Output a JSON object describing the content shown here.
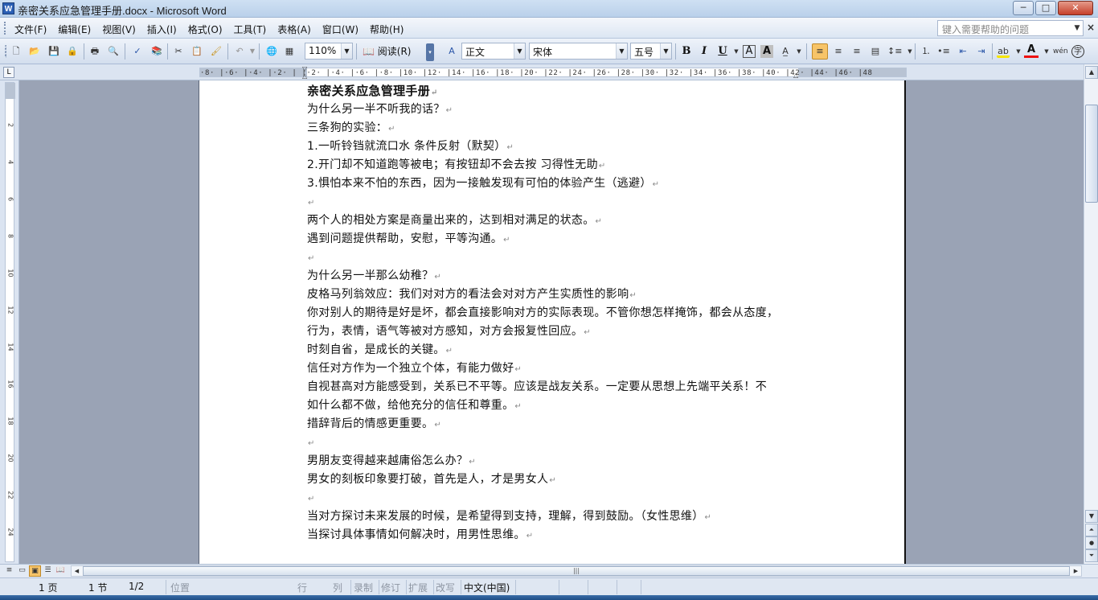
{
  "window": {
    "title": "亲密关系应急管理手册.docx - Microsoft Word",
    "app_icon": "W",
    "buttons": {
      "minimize": "─",
      "maximize": "□",
      "close": "✕"
    }
  },
  "menu": {
    "items": [
      "文件(F)",
      "编辑(E)",
      "视图(V)",
      "插入(I)",
      "格式(O)",
      "工具(T)",
      "表格(A)",
      "窗口(W)",
      "帮助(H)"
    ],
    "help_placeholder": "键入需要帮助的问题",
    "close_doc": "×"
  },
  "toolbar": {
    "zoom": "110%",
    "read_button": "阅读(R)",
    "style": "正文",
    "font": "宋体",
    "size": "五号",
    "bold": "B",
    "italic": "I",
    "underline": "U",
    "border_char": "A",
    "shade_char": "A",
    "font_color_char": "A",
    "active_alignment": "align-left",
    "accent_color": "#f7c468"
  },
  "ruler": {
    "ticks": "·8· |·6· |·4· |·2· |  |·2· |·4· |·6· |·8· |10· |12· |14· |16· |18· |20· |22· |24· |26· |28· |30· |32· |34· |36· |38· |40· |42· |44· |46· |48",
    "vertical": [
      "2",
      "4",
      "6",
      "8",
      "10",
      "12",
      "14",
      "16",
      "18",
      "20",
      "22",
      "24"
    ]
  },
  "document": {
    "paragraph_mark": "↵",
    "paragraphs": [
      {
        "text": "亲密关系应急管理手册",
        "heading": true
      },
      {
        "text": "为什么另一半不听我的话？"
      },
      {
        "text": "三条狗的实验："
      },
      {
        "text": "1.一听铃铛就流口水  条件反射（默契）"
      },
      {
        "text": "2.开门却不知道跑等被电；有按钮却不会去按  习得性无助"
      },
      {
        "text": "3.惧怕本来不怕的东西，因为一接触发现有可怕的体验产生（逃避）"
      },
      {
        "text": ""
      },
      {
        "text": "两个人的相处方案是商量出来的，达到相对满足的状态。"
      },
      {
        "text": "遇到问题提供帮助，安慰，平等沟通。"
      },
      {
        "text": ""
      },
      {
        "text": "为什么另一半那么幼稚？"
      },
      {
        "text": "皮格马列翁效应：我们对对方的看法会对对方产生实质性的影响"
      },
      {
        "text": "你对别人的期待是好是坏，都会直接影响对方的实际表现。不管你想怎样掩饰，都会从态度，",
        "wrap": true
      },
      {
        "text": "行为，表情，语气等被对方感知，对方会报复性回应。"
      },
      {
        "text": "时刻自省，是成长的关键。"
      },
      {
        "text": "信任对方作为一个独立个体，有能力做好"
      },
      {
        "text": "自视甚高对方能感受到，关系已不平等。应该是战友关系。一定要从思想上先端平关系！不",
        "wrap": true
      },
      {
        "text": "如什么都不做，给他充分的信任和尊重。"
      },
      {
        "text": "措辞背后的情感更重要。"
      },
      {
        "text": ""
      },
      {
        "text": "男朋友变得越来越庸俗怎么办？"
      },
      {
        "text": "男女的刻板印象要打破，首先是人，才是男女人"
      },
      {
        "text": ""
      },
      {
        "text": "当对方探讨未来发展的时候，是希望得到支持，理解，得到鼓励。（女性思维）"
      },
      {
        "text": "当探讨具体事情如何解决时，用男性思维。"
      }
    ]
  },
  "statusbar": {
    "page": "1 页",
    "section": "1 节",
    "page_of": "1/2",
    "position": "位置",
    "line": "行",
    "column": "列",
    "rec": "录制",
    "trk": "修订",
    "ext": "扩展",
    "ovr": "改写",
    "language": "中文(中国)"
  },
  "hscroll_grip": "|||"
}
